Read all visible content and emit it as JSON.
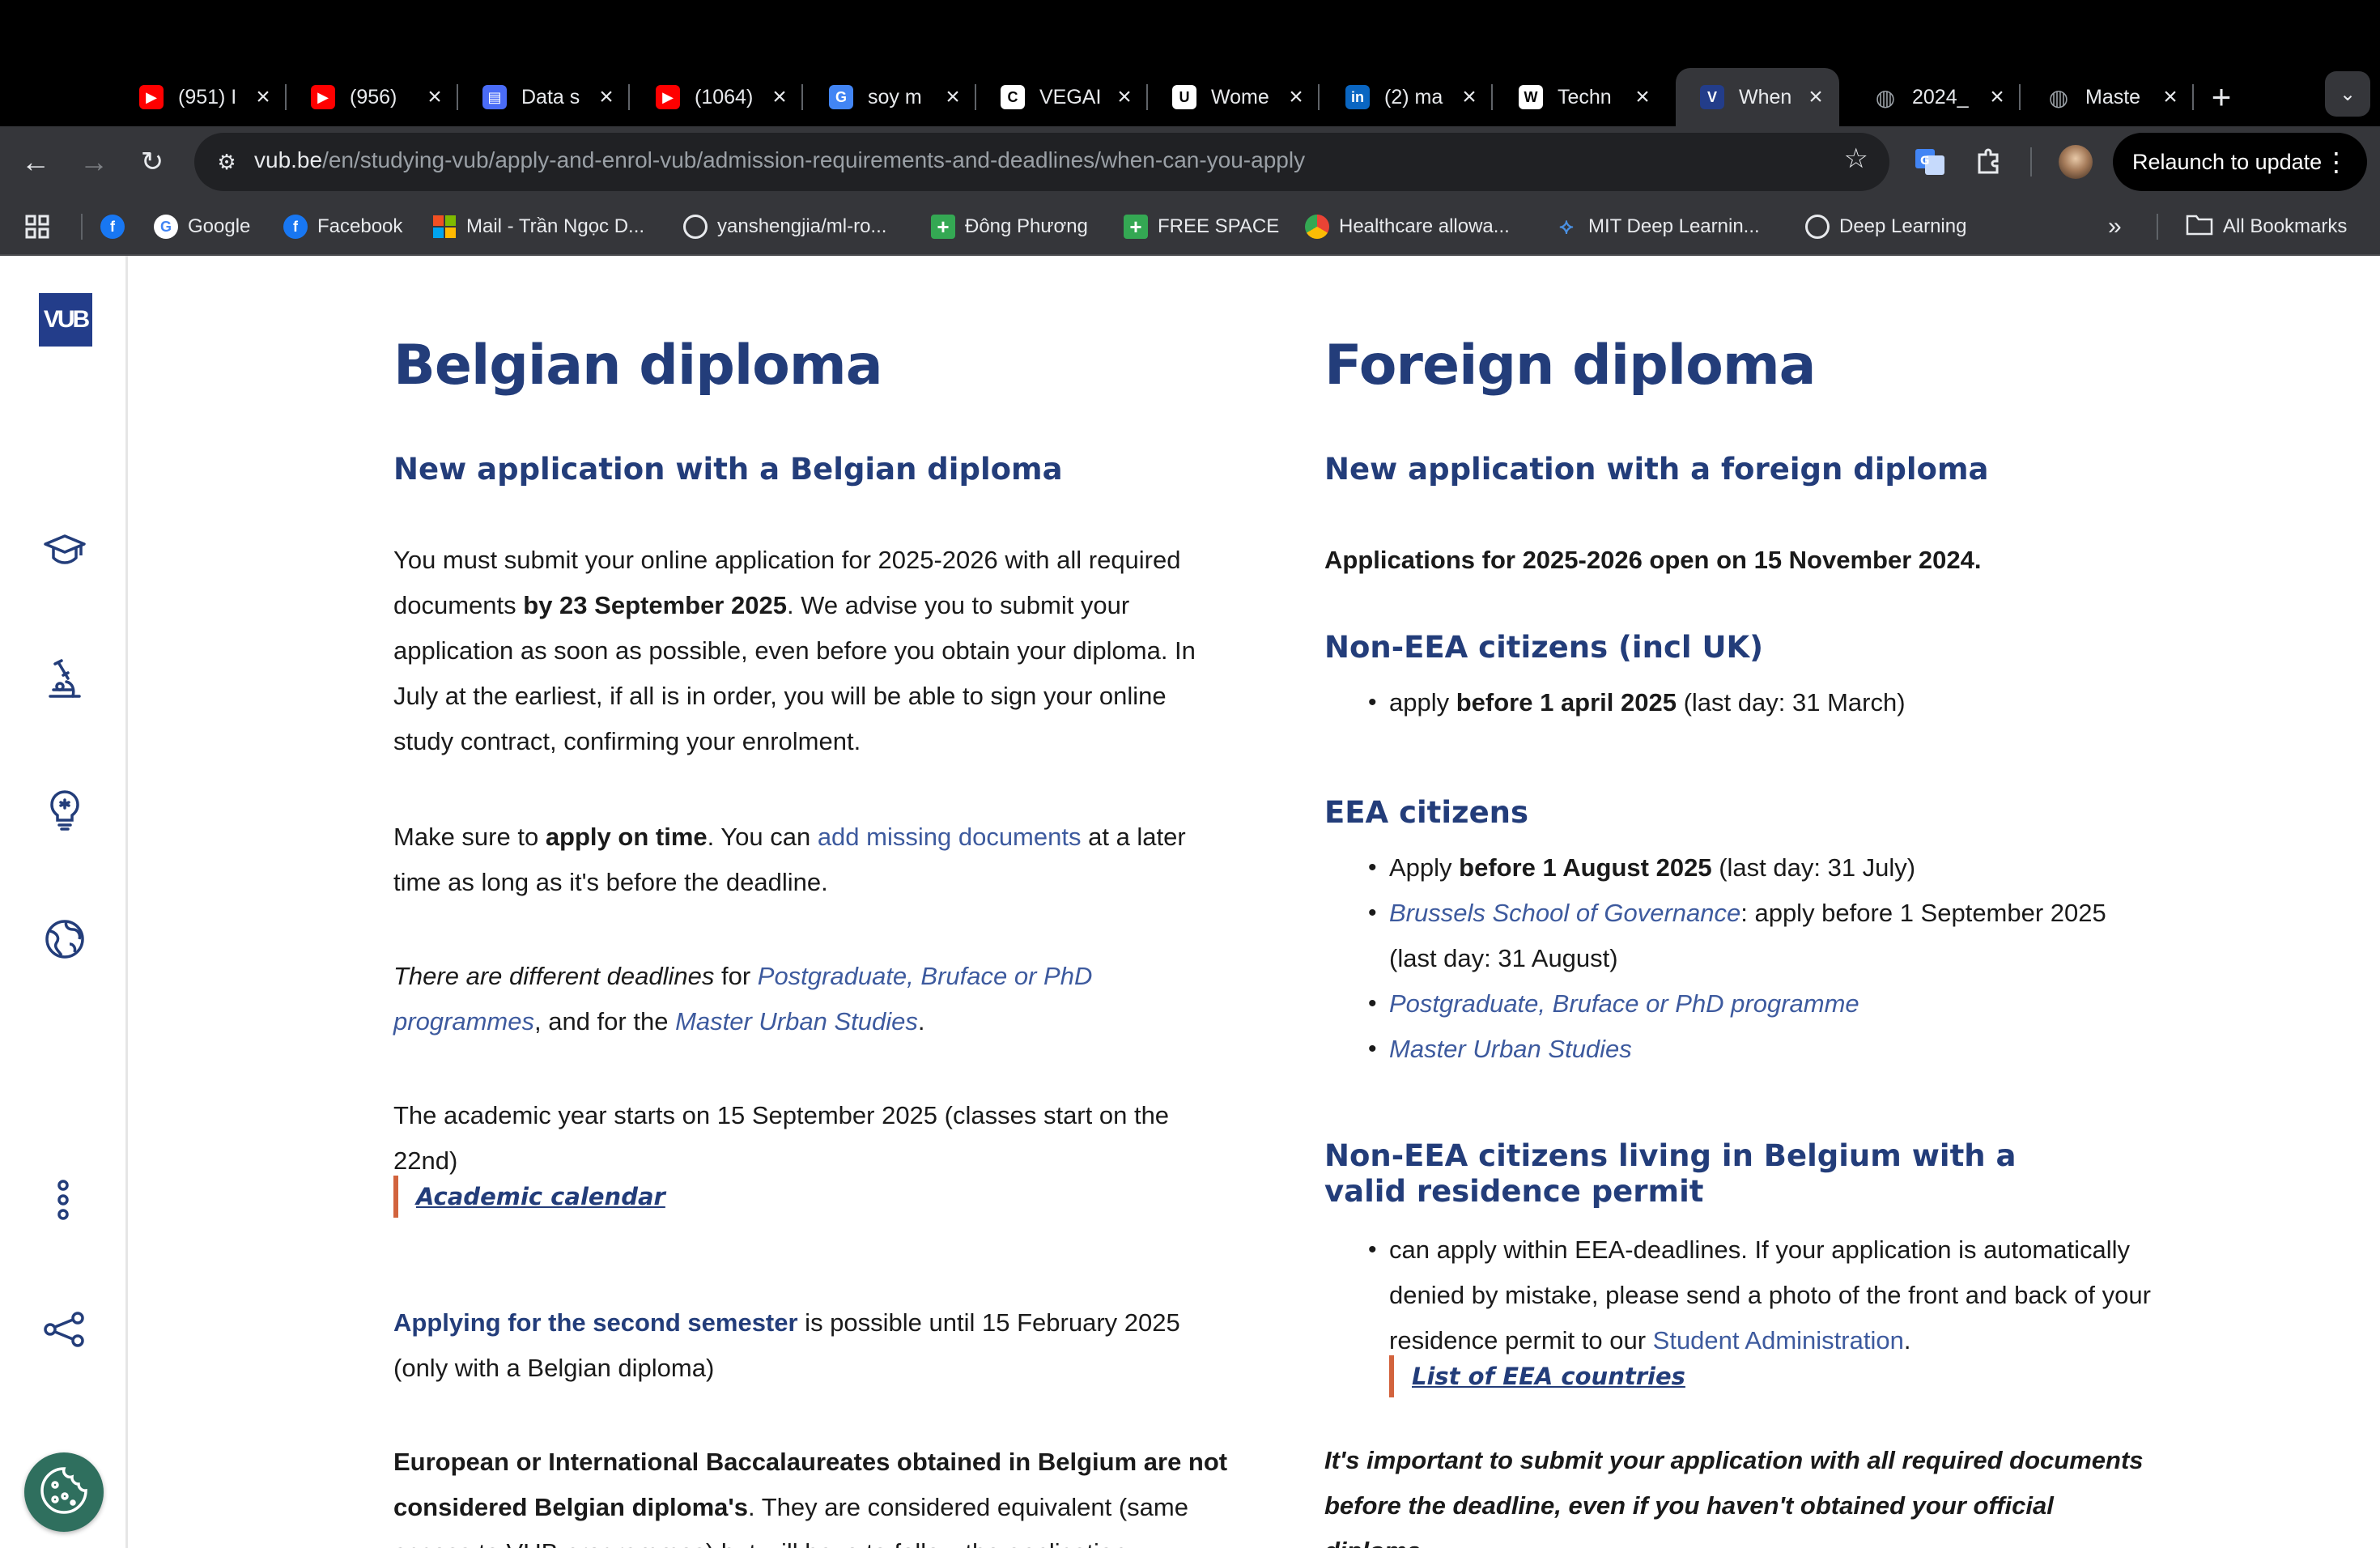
{
  "browser": {
    "tabs": [
      {
        "title": "(951) I",
        "icon": "youtube-icon",
        "color": "#ff0000"
      },
      {
        "title": "(956)",
        "icon": "youtube-icon",
        "color": "#ff0000"
      },
      {
        "title": "Data s",
        "icon": "document-icon",
        "color": "#4a6cf7"
      },
      {
        "title": "(1064)",
        "icon": "youtube-icon",
        "color": "#ff0000"
      },
      {
        "title": "soy m",
        "icon": "google-icon",
        "color": "#4285f4"
      },
      {
        "title": "VEGAI",
        "icon": "vega-icon",
        "color": "#ffffff"
      },
      {
        "title": "Wome",
        "icon": "uo-icon",
        "color": "#ffffff"
      },
      {
        "title": "(2) ma",
        "icon": "linkedin-icon",
        "color": "#0a66c2"
      },
      {
        "title": "Techn",
        "icon": "wikipedia-icon",
        "color": "#ffffff"
      },
      {
        "title": "When",
        "icon": "vub-icon",
        "color": "#233d8a"
      },
      {
        "title": "2024_",
        "icon": "globe-icon",
        "color": "#9aa0a6"
      },
      {
        "title": "Maste",
        "icon": "globe-icon",
        "color": "#9aa0a6"
      }
    ],
    "url_host": "vub.be",
    "url_path": "/en/studying-vub/apply-and-enrol-vub/admission-requirements-and-deadlines/when-can-you-apply",
    "relaunch_label": "Relaunch to update",
    "bookmarks": [
      {
        "label": "",
        "icon": "facebook-icon",
        "color": "#1877f2"
      },
      {
        "label": "Google",
        "icon": "google-icon",
        "color": "#4285f4"
      },
      {
        "label": "Facebook",
        "icon": "facebook-icon",
        "color": "#1877f2"
      },
      {
        "label": "Mail - Trần Ngọc D...",
        "icon": "microsoft-icon",
        "color": "#f25022"
      },
      {
        "label": "yanshengjia/ml-ro...",
        "icon": "github-icon",
        "color": "#ffffff"
      },
      {
        "label": "Đông Phương",
        "icon": "plus-icon",
        "color": "#34a853"
      },
      {
        "label": "FREE SPACE",
        "icon": "plus-icon",
        "color": "#34a853"
      },
      {
        "label": "Healthcare allowa...",
        "icon": "chrome-icon",
        "color": "#ea4335"
      },
      {
        "label": "MIT Deep Learnin...",
        "icon": "network-icon",
        "color": "#4a90e2"
      },
      {
        "label": "Deep Learning",
        "icon": "globe-icon",
        "color": "#e8eaed"
      }
    ],
    "all_bookmarks_label": "All Bookmarks"
  },
  "sidebar": {
    "logo_text": "VUB"
  },
  "belgian": {
    "title": "Belgian diploma",
    "subtitle": "New application with a Belgian diploma",
    "p1_a": "You must submit your online application for 2025-2026 with all required documents ",
    "p1_b": "by 23 September 2025",
    "p1_c": ". We advise you to submit your application as soon as possible, even before you obtain your diploma. In July at the earliest, if all is in order, you will be able to sign your online study contract, confirming your enrolment.",
    "p2_a": "Make sure to ",
    "p2_b": "apply on time",
    "p2_c": ". You can ",
    "p2_link": "add missing documents",
    "p2_d": " at a later time as long as it's before the deadline.",
    "p3_a": "There are different deadlines",
    "p3_b": " for ",
    "p3_link1": "Postgraduate, Bruface or PhD programmes",
    "p3_c": ", and for the ",
    "p3_link2": "Master Urban Studies",
    "p3_d": ".",
    "p4": "The academic year starts on 15 September 2025 (classes start on the 22nd)",
    "calendar_link": "Academic calendar",
    "p5_link": "Applying for the second semester",
    "p5_rest": " is possible until 15 February 2025 (only with a Belgian diploma)",
    "p6_a": "European or International Baccalaureates obtained in Belgium are not considered Belgian diploma's",
    "p6_b": ". They are considered equivalent (same access to VUB programmes) but will have to follow the application"
  },
  "foreign": {
    "title": "Foreign diploma",
    "subtitle": "New application with a foreign diploma",
    "open_note": "Applications for 2025-2026 open on 15 November 2024.",
    "nonEEA_heading": "Non-EEA citizens (incl UK)",
    "nonEEA_a": "apply ",
    "nonEEA_b": "before 1 april 2025",
    "nonEEA_c": " (last day: 31 March)",
    "eea_heading": "EEA citizens",
    "eea_1a": "Apply ",
    "eea_1b": "before 1 August 2025",
    "eea_1c": " (last day: 31 July)",
    "eea_2link": "Brussels School of Governance",
    "eea_2rest": ": apply before 1 September 2025 (last day: 31 August)",
    "eea_3link": "Postgraduate, Bruface or PhD programme",
    "eea_4link": "Master Urban Studies",
    "residence_heading": "Non-EEA citizens living in Belgium with a valid residence permit",
    "residence_text": "can apply within EEA-deadlines. If your application is automatically denied by mistake, please send a photo of the front and back of your residence permit to our ",
    "residence_link": "Student Administration",
    "residence_end": ".",
    "eea_list_link": "List of EEA countries",
    "important": "It's important to submit your application with all required documents before the deadline, even if you haven't obtained your official diploma"
  }
}
